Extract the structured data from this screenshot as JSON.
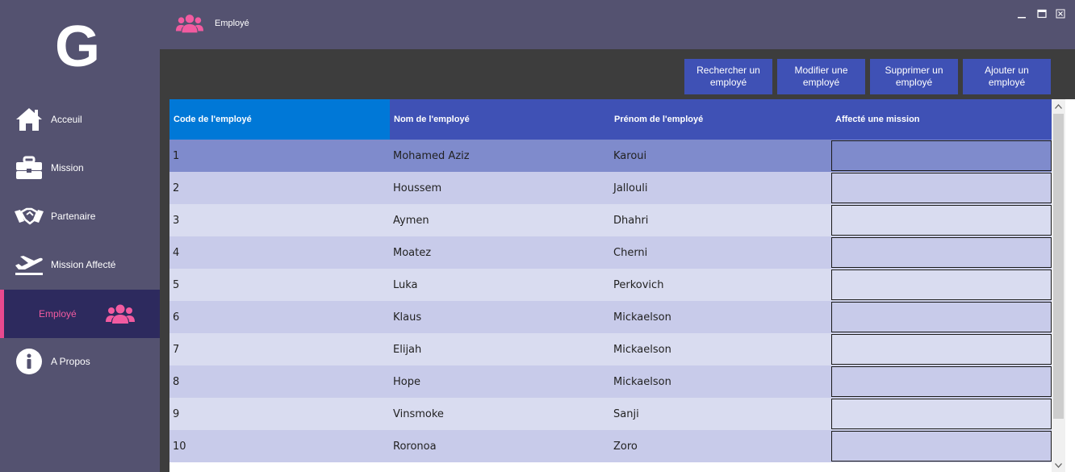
{
  "app": {
    "logo": "G",
    "window_controls": [
      "minimize",
      "maximize",
      "close"
    ]
  },
  "sidebar": {
    "items": [
      {
        "label": "Acceuil",
        "icon": "home-icon"
      },
      {
        "label": "Mission",
        "icon": "briefcase-icon"
      },
      {
        "label": "Partenaire",
        "icon": "handshake-icon"
      },
      {
        "label": "Mission Affecté",
        "icon": "plane-departure-icon"
      },
      {
        "label": "Employé",
        "icon": "users-icon",
        "active": true
      },
      {
        "label": "A Propos",
        "icon": "info-icon"
      }
    ]
  },
  "header": {
    "title": "Employé",
    "icon": "users-icon"
  },
  "toolbar": {
    "search_label": "Rechercher un employé",
    "edit_label": "Modifier une employé",
    "delete_label": "Supprimer un employé",
    "add_label": "Ajouter un employé"
  },
  "table": {
    "columns": [
      "Code de l'employé",
      "Nom de l'employé",
      "Prénom de l'employé",
      "Affecté une mission"
    ],
    "rows": [
      {
        "code": "1",
        "nom": "Mohamed Aziz",
        "prenom": "Karoui",
        "affecte": false
      },
      {
        "code": "2",
        "nom": "Houssem",
        "prenom": "Jallouli",
        "affecte": false
      },
      {
        "code": "3",
        "nom": "Aymen",
        "prenom": "Dhahri",
        "affecte": false
      },
      {
        "code": "4",
        "nom": "Moatez",
        "prenom": "Cherni",
        "affecte": false
      },
      {
        "code": "5",
        "nom": "Luka",
        "prenom": "Perkovich",
        "affecte": false
      },
      {
        "code": "6",
        "nom": "Klaus",
        "prenom": "Mickaelson",
        "affecte": false
      },
      {
        "code": "7",
        "nom": "Elijah",
        "prenom": "Mickaelson",
        "affecte": false
      },
      {
        "code": "8",
        "nom": "Hope",
        "prenom": "Mickaelson",
        "affecte": false
      },
      {
        "code": "9",
        "nom": "Vinsmoke",
        "prenom": "Sanji",
        "affecte": false
      },
      {
        "code": "10",
        "nom": "Roronoa",
        "prenom": "Zoro",
        "affecte": false
      }
    ]
  },
  "colors": {
    "sidebar_bg": "#545270",
    "active_bg": "#2d2a5e",
    "accent_pink": "#e8498f",
    "button_blue": "#3f51b5",
    "header_selected": "#0078d7",
    "row_selected": "#7f8bcc",
    "row_odd": "#c8cbea",
    "row_even": "#d9dcf0"
  }
}
